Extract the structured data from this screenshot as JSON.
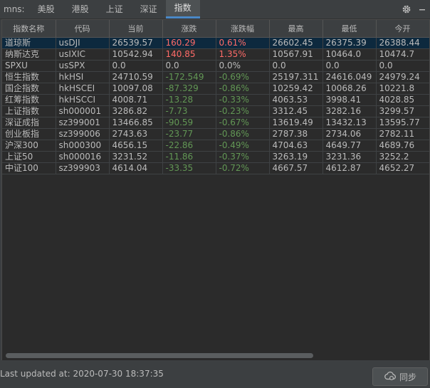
{
  "tabbar": {
    "prefix": "mns:",
    "tabs": [
      {
        "label": "美股",
        "active": false
      },
      {
        "label": "港股",
        "active": false
      },
      {
        "label": "上证",
        "active": false
      },
      {
        "label": "深证",
        "active": false
      },
      {
        "label": "指数",
        "active": true
      }
    ],
    "icons": [
      "gear-icon",
      "minimize-icon"
    ]
  },
  "table": {
    "columns": [
      "指数名称",
      "代码",
      "当前",
      "涨跌",
      "涨跌幅",
      "最高",
      "最低",
      "今开"
    ],
    "rows": [
      {
        "name": "道琼斯",
        "code": "usDJI",
        "current": "26539.57",
        "change": "160.29",
        "pct": "0.61%",
        "high": "26602.45",
        "low": "26375.39",
        "open": "26388.44",
        "dir": "up"
      },
      {
        "name": "纳斯达克",
        "code": "usIXIC",
        "current": "10542.94",
        "change": "140.85",
        "pct": "1.35%",
        "high": "10567.91",
        "low": "10464.0",
        "open": "10474.7",
        "dir": "up"
      },
      {
        "name": "SPXU",
        "code": "usSPX",
        "current": "0.0",
        "change": "0.0",
        "pct": "0.0%",
        "high": "0.0",
        "low": "0.0",
        "open": "0.0",
        "dir": "flat"
      },
      {
        "name": "恒生指数",
        "code": "hkHSI",
        "current": "24710.59",
        "change": "-172.549",
        "pct": "-0.69%",
        "high": "25197.311",
        "low": "24616.049",
        "open": "24979.24",
        "dir": "down"
      },
      {
        "name": "国企指数",
        "code": "hkHSCEI",
        "current": "10097.08",
        "change": "-87.329",
        "pct": "-0.86%",
        "high": "10259.42",
        "low": "10068.26",
        "open": "10221.8",
        "dir": "down"
      },
      {
        "name": "红筹指数",
        "code": "hkHSCCI",
        "current": "4008.71",
        "change": "-13.28",
        "pct": "-0.33%",
        "high": "4063.53",
        "low": "3998.41",
        "open": "4028.85",
        "dir": "down"
      },
      {
        "name": "上证指数",
        "code": "sh000001",
        "current": "3286.82",
        "change": "-7.73",
        "pct": "-0.23%",
        "high": "3312.45",
        "low": "3282.16",
        "open": "3299.57",
        "dir": "down"
      },
      {
        "name": "深证成指",
        "code": "sz399001",
        "current": "13466.85",
        "change": "-90.59",
        "pct": "-0.67%",
        "high": "13619.49",
        "low": "13432.13",
        "open": "13595.77",
        "dir": "down"
      },
      {
        "name": "创业板指",
        "code": "sz399006",
        "current": "2743.63",
        "change": "-23.77",
        "pct": "-0.86%",
        "high": "2787.38",
        "low": "2734.06",
        "open": "2782.11",
        "dir": "down"
      },
      {
        "name": "沪深300",
        "code": "sh000300",
        "current": "4656.15",
        "change": "-22.86",
        "pct": "-0.49%",
        "high": "4704.63",
        "low": "4649.77",
        "open": "4689.76",
        "dir": "down"
      },
      {
        "name": "上证50",
        "code": "sh000016",
        "current": "3231.52",
        "change": "-11.86",
        "pct": "-0.37%",
        "high": "3263.19",
        "low": "3231.36",
        "open": "3252.2",
        "dir": "down"
      },
      {
        "name": "中证100",
        "code": "sz399903",
        "current": "4614.04",
        "change": "-33.35",
        "pct": "-0.72%",
        "high": "4667.57",
        "low": "4612.87",
        "open": "4652.27",
        "dir": "down"
      }
    ]
  },
  "footer": {
    "status": "Last updated at: 2020-07-30 18:37:35",
    "sync_label": "同步",
    "sync_icon": "cloud-sync-icon"
  },
  "colors": {
    "up": "#ff6b68",
    "down": "#629755",
    "accent": "#4a88c7"
  }
}
